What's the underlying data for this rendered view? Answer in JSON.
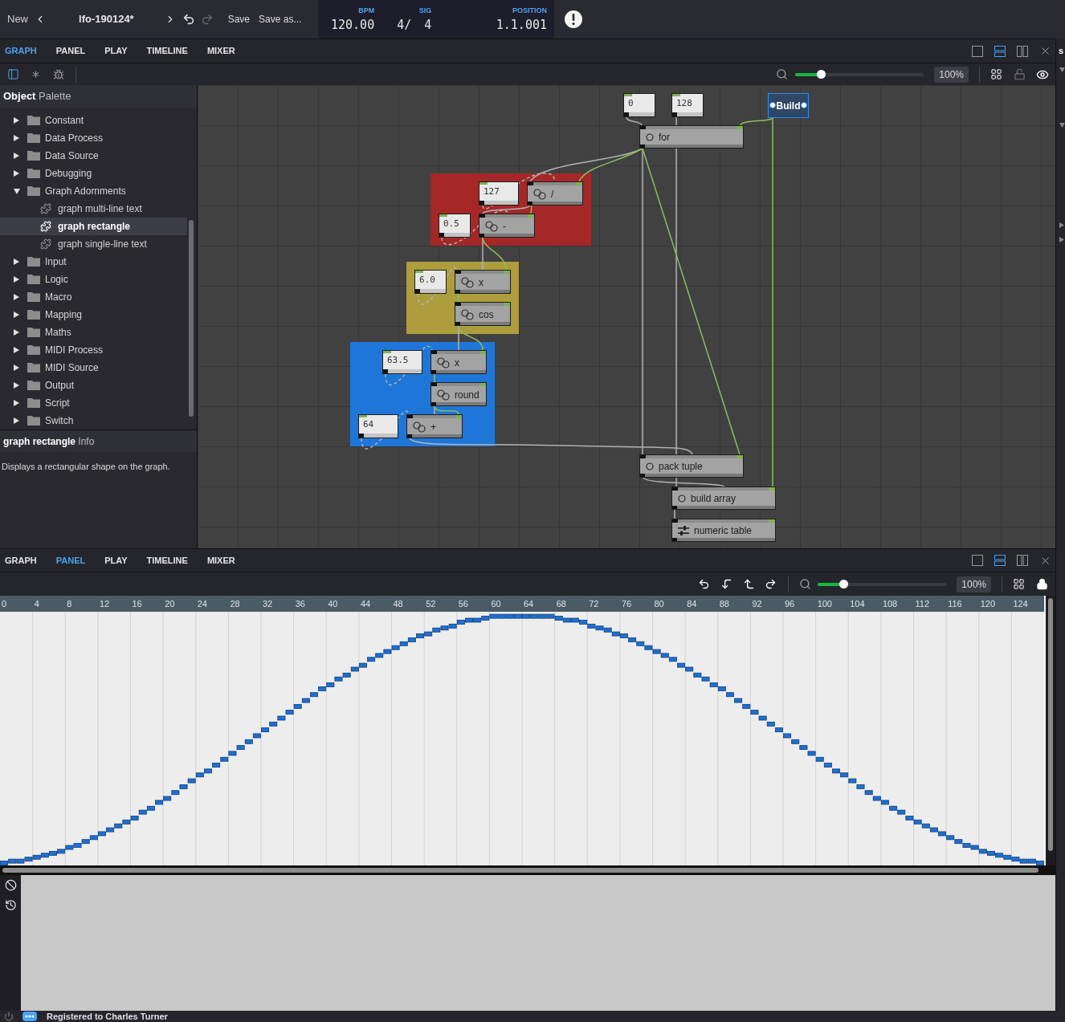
{
  "top_bar": {
    "new": "New",
    "title": "lfo-190124*",
    "undo_enabled": true,
    "redo_enabled": false,
    "save": "Save",
    "save_as": "Save as..."
  },
  "transport": {
    "bpm": {
      "label": "BPM",
      "value": "120.00"
    },
    "sig": {
      "label": "SIG",
      "numerator": "4/",
      "denominator": "4"
    },
    "position": {
      "label": "POSITION",
      "value": "1.1.001"
    }
  },
  "graph_panel": {
    "tabs": [
      {
        "label": "GRAPH",
        "selected": true
      },
      {
        "label": "PANEL",
        "selected": false
      },
      {
        "label": "PLAY",
        "selected": false
      },
      {
        "label": "TIMELINE",
        "selected": false
      },
      {
        "label": "MIXER",
        "selected": false
      }
    ],
    "layouts": [
      {
        "kind": "single",
        "selected": false
      },
      {
        "kind": "rows",
        "selected": true
      },
      {
        "kind": "columns",
        "selected": false
      }
    ],
    "palette_visible": true,
    "zoom": {
      "level": 0.2,
      "reading": "100%"
    },
    "locked": false
  },
  "palette": {
    "title": "**Object** Palette",
    "items": [
      {
        "label": "Constant",
        "expanded": false,
        "selected": false
      },
      {
        "label": "Data Process",
        "expanded": false,
        "selected": false
      },
      {
        "label": "Data Source",
        "expanded": false,
        "selected": false
      },
      {
        "label": "Debugging",
        "expanded": false,
        "selected": false
      },
      {
        "label": "Graph Adornments",
        "expanded": true,
        "selected": false,
        "children": [
          {
            "label": "graph multi-line text",
            "selected": false
          },
          {
            "label": "graph rectangle",
            "selected": true
          },
          {
            "label": "graph single-line text",
            "selected": false
          }
        ]
      },
      {
        "label": "Input",
        "expanded": false,
        "selected": false
      },
      {
        "label": "Logic",
        "expanded": false,
        "selected": false
      },
      {
        "label": "Macro",
        "expanded": false,
        "selected": false
      },
      {
        "label": "Mapping",
        "expanded": false,
        "selected": false
      },
      {
        "label": "Maths",
        "expanded": false,
        "selected": false
      },
      {
        "label": "MIDI Process",
        "expanded": false,
        "selected": false
      },
      {
        "label": "MIDI Source",
        "expanded": false,
        "selected": false
      },
      {
        "label": "Output",
        "expanded": false,
        "selected": false
      },
      {
        "label": "Script",
        "expanded": false,
        "selected": false
      },
      {
        "label": "Switch",
        "expanded": false,
        "selected": false
      }
    ],
    "info_title": "**graph rectangle** Info",
    "info_text": "Displays a rectangular shape on the graph."
  },
  "graph": {
    "regions": [
      {
        "color": "#a52727"
      },
      {
        "color": "#ad9d3c"
      },
      {
        "color": "#1e77d8"
      }
    ],
    "nodes": [
      {
        "kind": "value",
        "text": "0"
      },
      {
        "kind": "value",
        "text": "128"
      },
      {
        "kind": "button",
        "text": "Build"
      },
      {
        "kind": "control",
        "text": "for"
      },
      {
        "kind": "value",
        "text": "127"
      },
      {
        "kind": "operator",
        "text": "/"
      },
      {
        "kind": "value",
        "text": "0.5"
      },
      {
        "kind": "operator",
        "text": "-"
      },
      {
        "kind": "value",
        "text": "6.0"
      },
      {
        "kind": "operator",
        "text": "x"
      },
      {
        "kind": "operator",
        "text": "cos"
      },
      {
        "kind": "value",
        "text": "63.5"
      },
      {
        "kind": "operator",
        "text": "x"
      },
      {
        "kind": "operator",
        "text": "round"
      },
      {
        "kind": "value",
        "text": "64"
      },
      {
        "kind": "operator",
        "text": "+"
      },
      {
        "kind": "control",
        "text": "pack tuple"
      },
      {
        "kind": "control",
        "text": "build array"
      },
      {
        "kind": "table",
        "text": "numeric table"
      }
    ]
  },
  "panel_view": {
    "tabs": [
      {
        "label": "GRAPH",
        "selected": false
      },
      {
        "label": "PANEL",
        "selected": true
      },
      {
        "label": "PLAY",
        "selected": false
      },
      {
        "label": "TIMELINE",
        "selected": false
      },
      {
        "label": "MIXER",
        "selected": false
      }
    ],
    "layouts": [
      {
        "kind": "single",
        "selected": false
      },
      {
        "kind": "rows",
        "selected": true
      },
      {
        "kind": "columns",
        "selected": false
      }
    ],
    "zoom": {
      "level": 0.2,
      "reading": "100%"
    },
    "locked": true,
    "ruler": [
      "0",
      "4",
      "8",
      "12",
      "16",
      "20",
      "24",
      "28",
      "32",
      "36",
      "40",
      "44",
      "48",
      "52",
      "56",
      "60",
      "64",
      "68",
      "72",
      "76",
      "80",
      "84",
      "88",
      "92",
      "96",
      "100",
      "104",
      "108",
      "112",
      "116",
      "120",
      "124"
    ]
  },
  "right_panel": {
    "title": "s",
    "sections": [
      {
        "expanded": true
      },
      {
        "expanded": true
      },
      {
        "expanded": false
      },
      {
        "expanded": false
      }
    ]
  },
  "status_bar": {
    "text": "Registered to Charles Turner"
  }
}
